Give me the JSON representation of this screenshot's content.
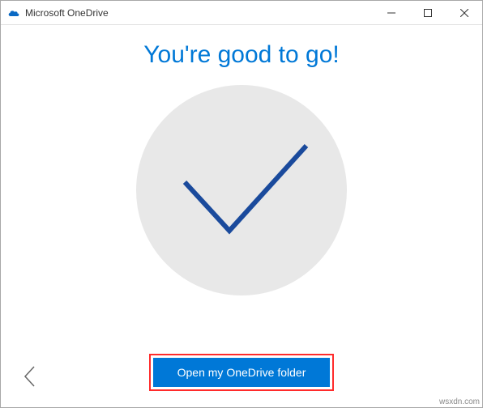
{
  "window": {
    "title": "Microsoft OneDrive"
  },
  "content": {
    "headline": "You're good to go!"
  },
  "footer": {
    "open_button_label": "Open my OneDrive folder"
  },
  "watermark": "wsxdn.com"
}
